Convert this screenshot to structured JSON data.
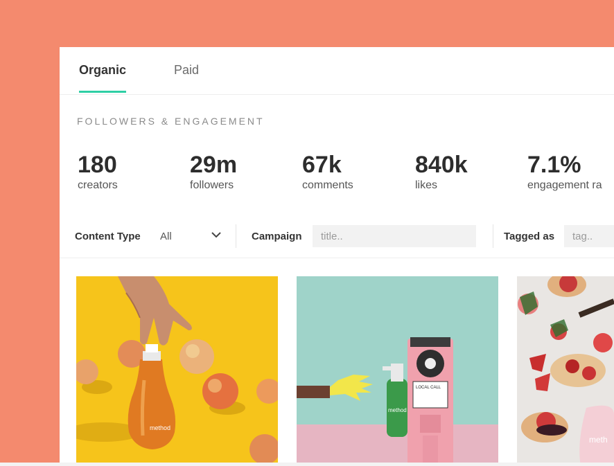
{
  "tabs": [
    {
      "label": "Organic",
      "active": true
    },
    {
      "label": "Paid",
      "active": false
    }
  ],
  "section_title": "FOLLOWERS & ENGAGEMENT",
  "stats": [
    {
      "value": "180",
      "label": "creators"
    },
    {
      "value": "29m",
      "label": "followers"
    },
    {
      "value": "67k",
      "label": "comments"
    },
    {
      "value": "840k",
      "label": "likes"
    },
    {
      "value": "7.1%",
      "label": "engagement ra"
    }
  ],
  "filters": {
    "content_type_label": "Content Type",
    "content_type_value": "All",
    "campaign_label": "Campaign",
    "campaign_placeholder": "title..",
    "tagged_label": "Tagged as",
    "tagged_placeholder": "tag.."
  },
  "images": {
    "img1_text": "method",
    "img2_phone_text": "LOCAL CALL",
    "img2_bottle_text": "method",
    "img3_text": "meth"
  },
  "colors": {
    "background": "#f48a6e",
    "accent": "#2ecfa5"
  }
}
